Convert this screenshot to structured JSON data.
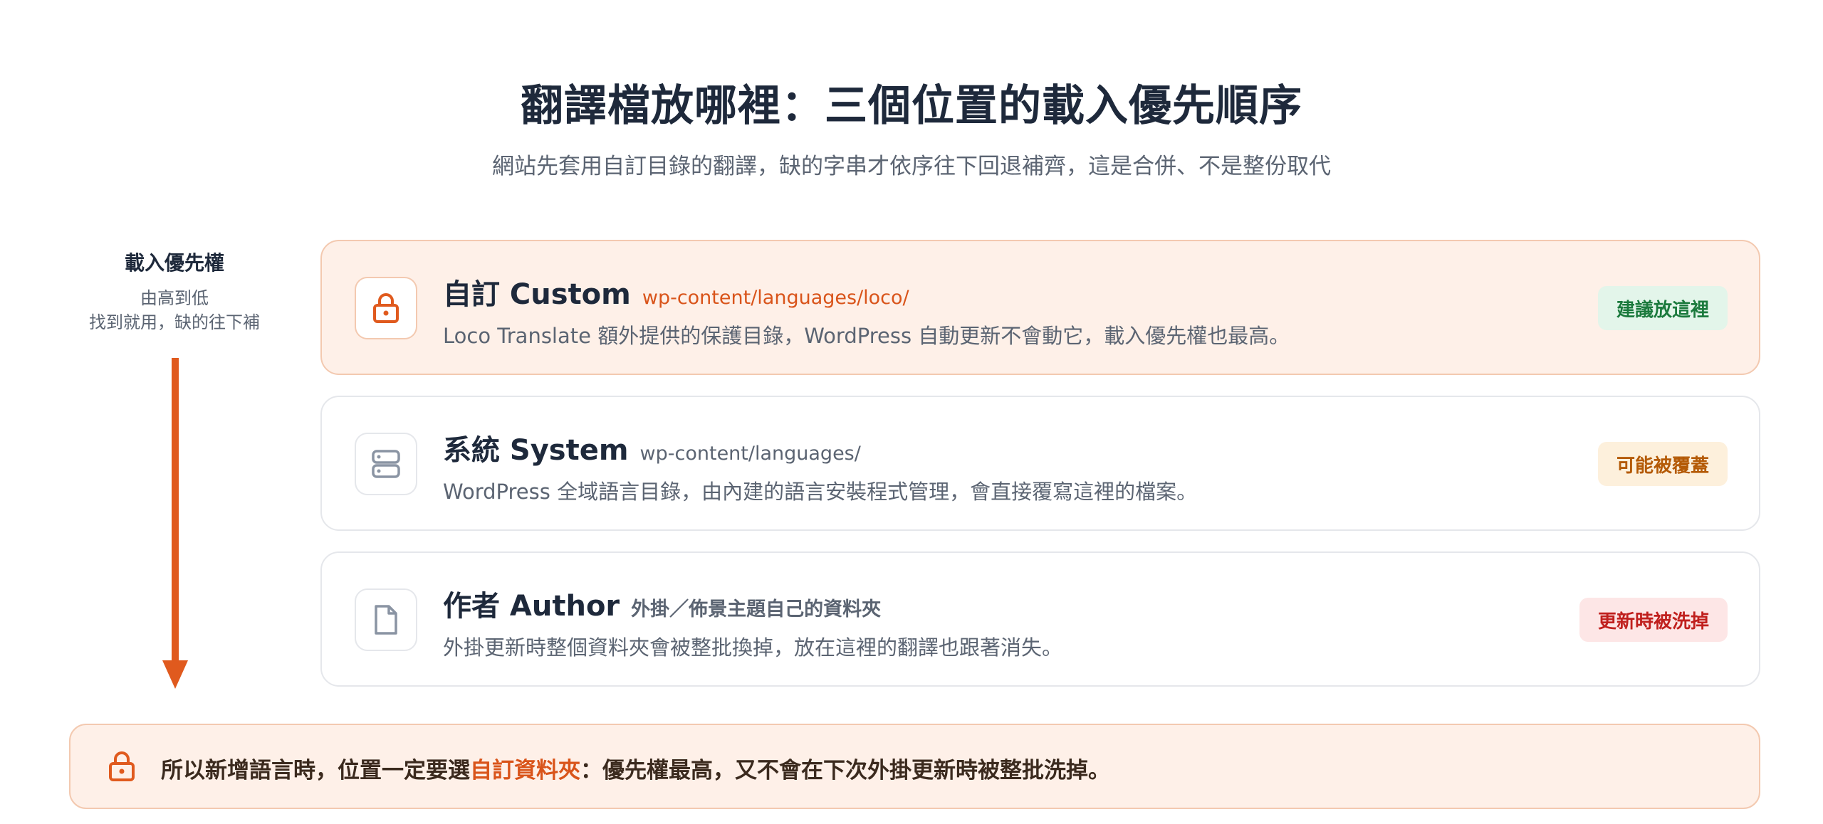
{
  "header": {
    "title": "翻譯檔放哪裡：三個位置的載入優先順序",
    "subtitle": "網站先套用自訂目錄的翻譯，缺的字串才依序往下回退補齊，這是合併、不是整份取代"
  },
  "priority": {
    "title": "載入優先權",
    "line1": "由高到低",
    "line2": "找到就用，缺的往下補"
  },
  "cards": [
    {
      "name": "自訂 Custom",
      "path": "wp-content/languages/loco/",
      "description": "Loco Translate 額外提供的保護目錄，WordPress 自動更新不會動它，載入優先權也最高。",
      "badge": "建議放這裡",
      "icon": "lock-icon"
    },
    {
      "name": "系統 System",
      "path": "wp-content/languages/",
      "description": "WordPress 全域語言目錄，由內建的語言安裝程式管理，會直接覆寫這裡的檔案。",
      "badge": "可能被覆蓋",
      "icon": "server-icon"
    },
    {
      "name": "作者 Author",
      "path": "外掛／佈景主題自己的資料夾",
      "description": "外掛更新時整個資料夾會被整批換掉，放在這裡的翻譯也跟著消失。",
      "badge": "更新時被洗掉",
      "icon": "file-icon"
    }
  ],
  "note": {
    "prefix": "所以新增語言時，位置一定要選",
    "highlight": "自訂資料夾",
    "suffix": "：優先權最高，又不會在下次外掛更新時被整批洗掉。"
  },
  "colors": {
    "accent": "#e05a1e",
    "custom_bg": "#fef0e8",
    "badge_green": "#1b7a3d",
    "badge_amber": "#b45a06",
    "badge_red": "#c0201e"
  }
}
